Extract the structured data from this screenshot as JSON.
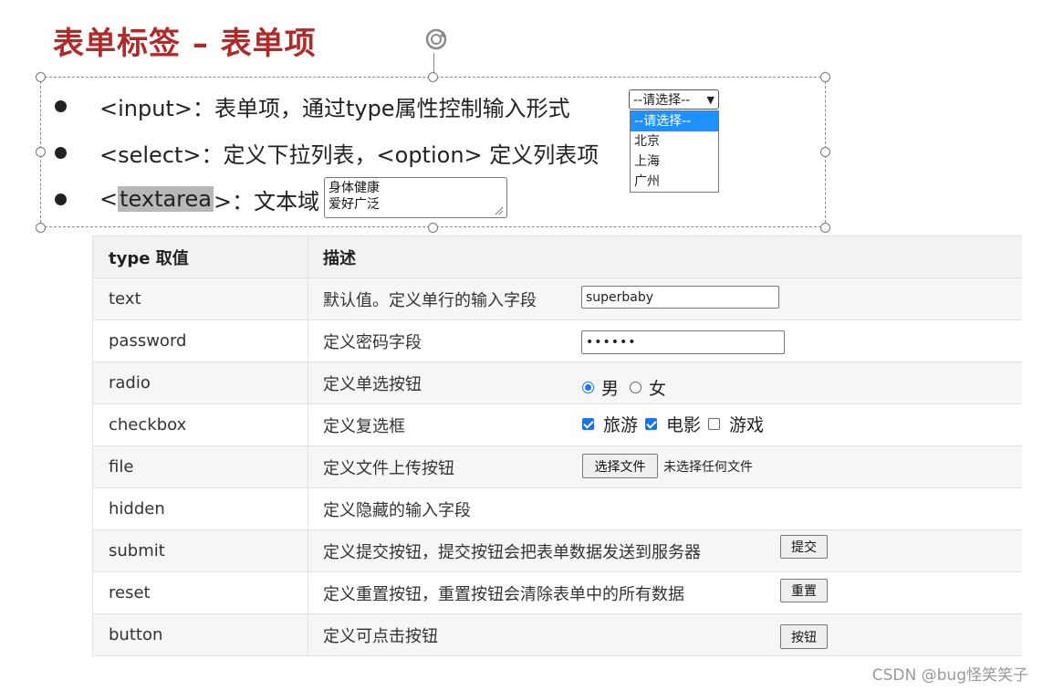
{
  "title": "表单标签 – 表单项",
  "bullets": [
    {
      "pre": "<input>：表单项，通过type属性控制输入形式"
    },
    {
      "pre": "<select>：定义下拉列表，<option> 定义列表项"
    },
    {
      "pre": "<",
      "highlight": "textarea",
      "post": ">：文本域"
    }
  ],
  "select": {
    "selected": "--请选择--",
    "options": [
      "--请选择--",
      "北京",
      "上海",
      "广州"
    ]
  },
  "textarea": {
    "value": "身体健康\n爱好广泛"
  },
  "table": {
    "headers": [
      "type 取值",
      "描述"
    ],
    "rows": [
      {
        "type": "text",
        "desc": "默认值。定义单行的输入字段"
      },
      {
        "type": "password",
        "desc": "定义密码字段"
      },
      {
        "type": "radio",
        "desc": "定义单选按钮"
      },
      {
        "type": "checkbox",
        "desc": "定义复选框"
      },
      {
        "type": "file",
        "desc": "定义文件上传按钮"
      },
      {
        "type": "hidden",
        "desc": "定义隐藏的输入字段"
      },
      {
        "type": "submit",
        "desc": "定义提交按钮，提交按钮会把表单数据发送到服务器"
      },
      {
        "type": "reset",
        "desc": "定义重置按钮，重置按钮会清除表单中的所有数据"
      },
      {
        "type": "button",
        "desc": "定义可点击按钮"
      }
    ]
  },
  "demo": {
    "text_value": "superbaby",
    "password_value": "••••••",
    "radio": [
      {
        "label": "男",
        "checked": true
      },
      {
        "label": "女",
        "checked": false
      }
    ],
    "checkbox": [
      {
        "label": "旅游",
        "checked": true
      },
      {
        "label": "电影",
        "checked": true
      },
      {
        "label": "游戏",
        "checked": false
      }
    ],
    "file_button": "选择文件",
    "file_status": "未选择任何文件",
    "submit_label": "提交",
    "reset_label": "重置",
    "button_label": "按钮"
  },
  "watermark": "CSDN @bug怪笑笑子",
  "colors": {
    "title": "#b02a2a",
    "accent": "#1a73e8",
    "select_highlight": "#1e90ff"
  }
}
